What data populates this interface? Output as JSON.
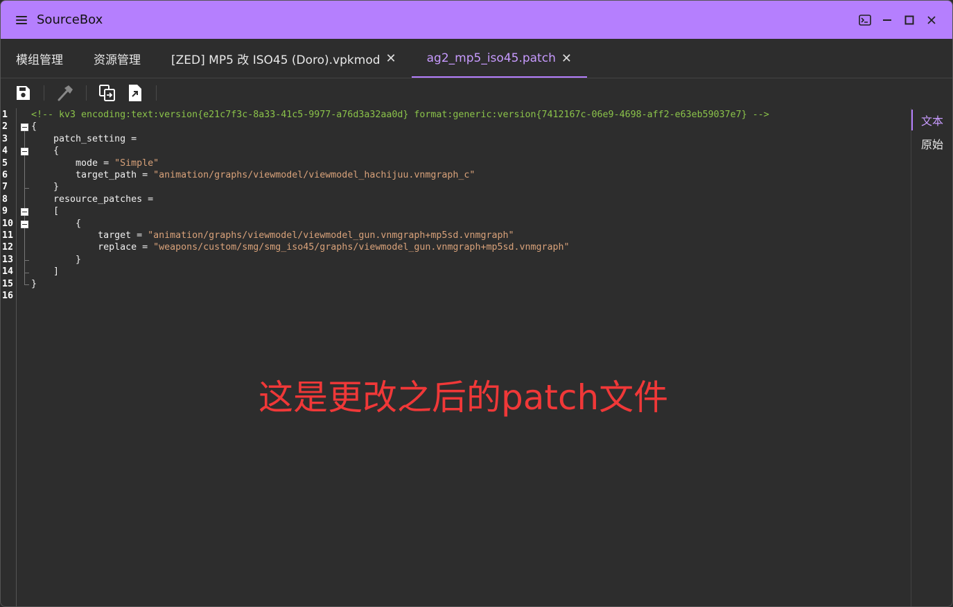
{
  "app": {
    "title": "SourceBox"
  },
  "tabs": [
    {
      "label": "模组管理",
      "closable": false,
      "active": false
    },
    {
      "label": "资源管理",
      "closable": false,
      "active": false
    },
    {
      "label": "[ZED] MP5 改 ISO45 (Doro).vpkmod",
      "closable": true,
      "active": false
    },
    {
      "label": "ag2_mp5_iso45.patch",
      "closable": true,
      "active": true
    }
  ],
  "tab_close_glyph": "✕",
  "toolbar": {
    "icons": [
      "save-icon",
      "build-icon",
      "export-icon",
      "file-export-icon"
    ]
  },
  "editor": {
    "lines": [
      {
        "n": "1",
        "parts": [
          {
            "t": "<!-- kv3 encoding:text:version{e21c7f3c-8a33-41c5-9977-a76d3a32aa0d} format:generic:version{7412167c-06e9-4698-aff2-e63eb59037e7} -->",
            "c": "comment"
          }
        ]
      },
      {
        "n": "2",
        "parts": [
          {
            "t": "{",
            "c": ""
          }
        ]
      },
      {
        "n": "3",
        "parts": [
          {
            "t": "    patch_setting =",
            "c": ""
          }
        ]
      },
      {
        "n": "4",
        "parts": [
          {
            "t": "    {",
            "c": ""
          }
        ]
      },
      {
        "n": "5",
        "parts": [
          {
            "t": "        mode = ",
            "c": ""
          },
          {
            "t": "\"Simple\"",
            "c": "str"
          }
        ]
      },
      {
        "n": "6",
        "parts": [
          {
            "t": "        target_path = ",
            "c": ""
          },
          {
            "t": "\"animation/graphs/viewmodel/viewmodel_hachijuu.vnmgraph_c\"",
            "c": "str"
          }
        ]
      },
      {
        "n": "7",
        "parts": [
          {
            "t": "    }",
            "c": ""
          }
        ]
      },
      {
        "n": "8",
        "parts": [
          {
            "t": "    resource_patches =",
            "c": ""
          }
        ]
      },
      {
        "n": "9",
        "parts": [
          {
            "t": "    [",
            "c": ""
          }
        ]
      },
      {
        "n": "10",
        "parts": [
          {
            "t": "        {",
            "c": ""
          }
        ]
      },
      {
        "n": "11",
        "parts": [
          {
            "t": "            target = ",
            "c": ""
          },
          {
            "t": "\"animation/graphs/viewmodel/viewmodel_gun.vnmgraph+mp5sd.vnmgraph\"",
            "c": "str"
          }
        ]
      },
      {
        "n": "12",
        "parts": [
          {
            "t": "            replace = ",
            "c": ""
          },
          {
            "t": "\"weapons/custom/smg/smg_iso45/graphs/viewmodel_gun.vnmgraph+mp5sd.vnmgraph\"",
            "c": "str"
          }
        ]
      },
      {
        "n": "13",
        "parts": [
          {
            "t": "        }",
            "c": ""
          }
        ]
      },
      {
        "n": "14",
        "parts": [
          {
            "t": "    ]",
            "c": ""
          }
        ]
      },
      {
        "n": "15",
        "parts": [
          {
            "t": "}",
            "c": ""
          }
        ]
      },
      {
        "n": "16",
        "parts": [
          {
            "t": "",
            "c": ""
          }
        ]
      }
    ],
    "fold_markers": [
      "2",
      "4",
      "9",
      "10"
    ]
  },
  "view_tabs": [
    {
      "label": "文本",
      "active": true
    },
    {
      "label": "原始",
      "active": false
    }
  ],
  "annotation": {
    "text": "这是更改之后的patch文件",
    "color": "#f03838"
  },
  "colors": {
    "accent": "#b57ffe",
    "titlebar": "#b57ffe",
    "comment": "#8bc34a",
    "string": "#d9a27a"
  }
}
